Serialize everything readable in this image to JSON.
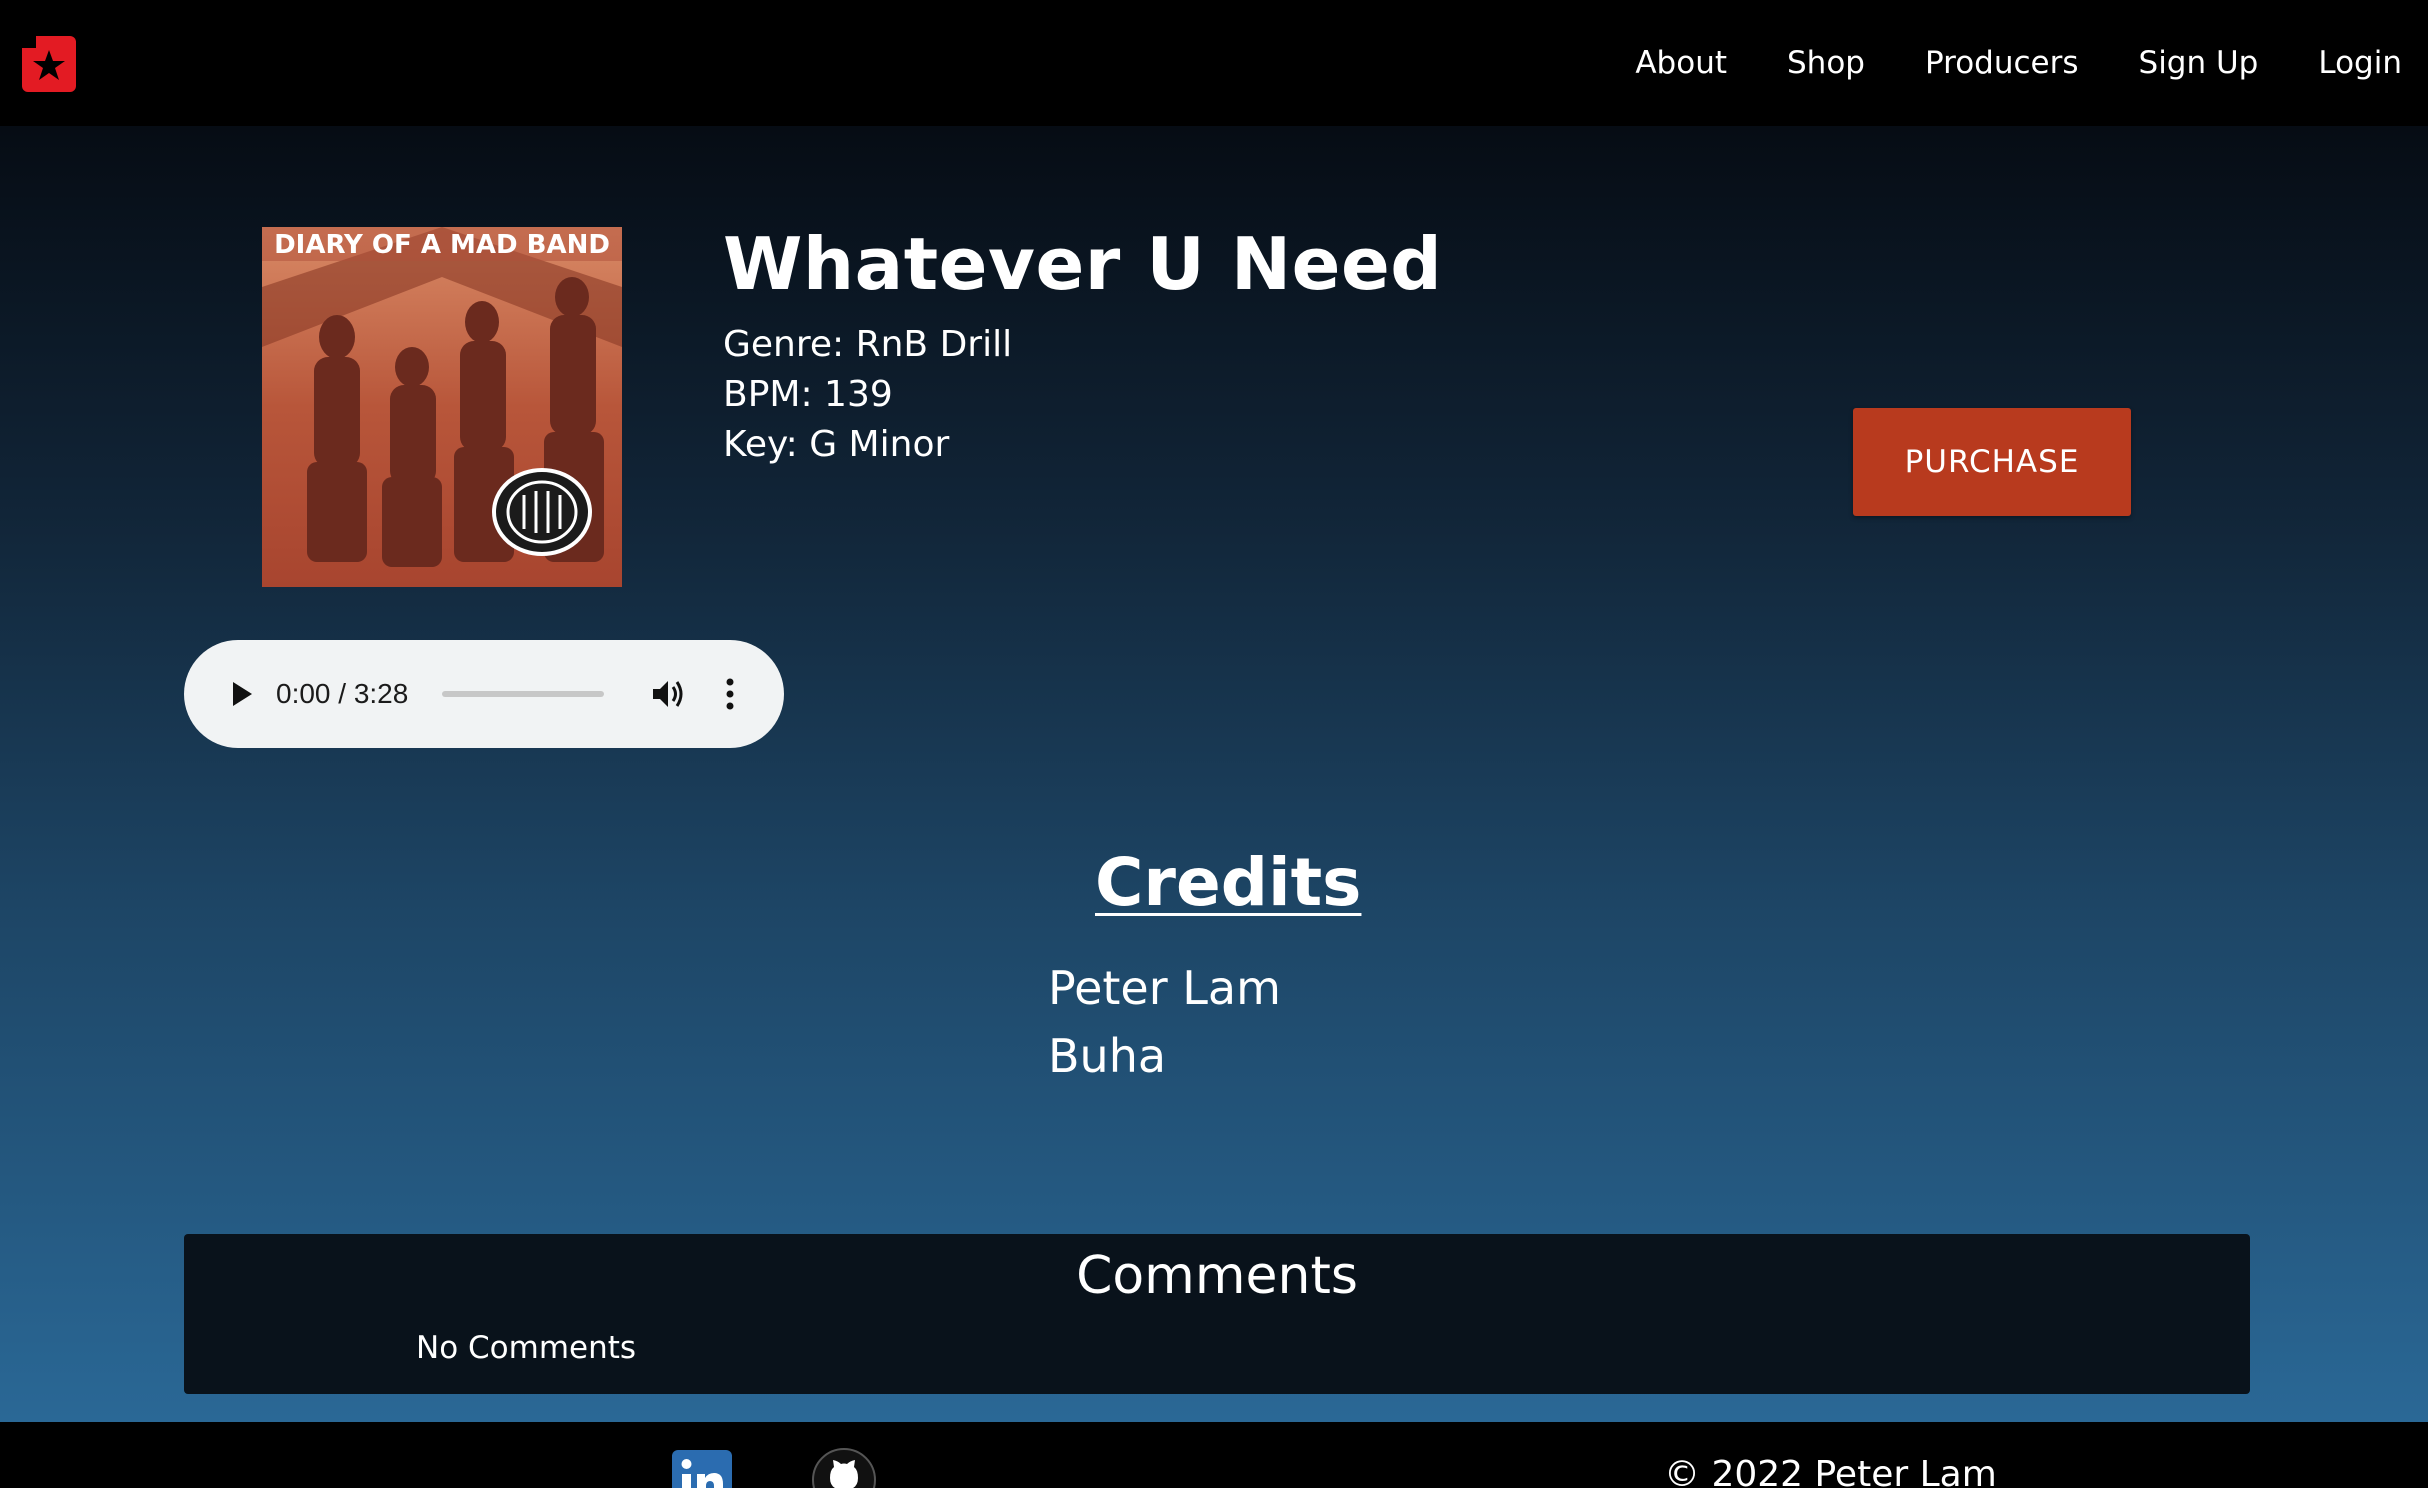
{
  "nav": {
    "logo": "beatstars-logo-icon",
    "links": [
      "About",
      "Shop",
      "Producers",
      "Sign Up",
      "Login"
    ]
  },
  "beat": {
    "title": "Whatever U Need",
    "genre": "Genre: RnB Drill",
    "bpm": "BPM: 139",
    "key": "Key: G Minor",
    "cover_text": "DIARY OF A MAD BAND",
    "purchase_label": "PURCHASE"
  },
  "player": {
    "time": "0:00 / 3:28",
    "progress": 0
  },
  "credits": {
    "title": "Credits",
    "names": [
      "Peter Lam",
      "Buha"
    ]
  },
  "comments": {
    "title": "Comments",
    "empty_text": "No Comments"
  },
  "footer": {
    "copyright": "© 2022 Peter Lam"
  },
  "colors": {
    "accent": "#b83a1e",
    "logo": "#e31b23",
    "background_top": "#060c14",
    "background_bottom": "#2a6896"
  }
}
